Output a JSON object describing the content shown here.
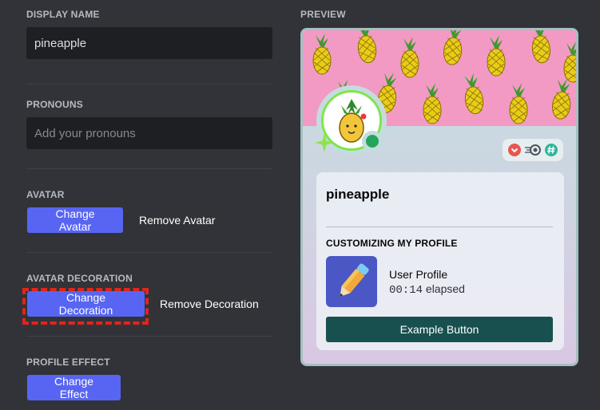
{
  "settings": {
    "display_name": {
      "label": "DISPLAY NAME",
      "value": "pineapple"
    },
    "pronouns": {
      "label": "PRONOUNS",
      "placeholder": "Add your pronouns"
    },
    "avatar": {
      "label": "AVATAR",
      "change": "Change Avatar",
      "remove": "Remove Avatar"
    },
    "decoration": {
      "label": "AVATAR DECORATION",
      "change": "Change Decoration",
      "remove": "Remove Decoration"
    },
    "effect": {
      "label": "PROFILE EFFECT",
      "change": "Change Effect"
    }
  },
  "preview": {
    "label": "PREVIEW",
    "username": "pineapple",
    "status": "online",
    "status_color": "#23a55a",
    "badges": [
      "heart-badge",
      "speed-badge",
      "hashtag-badge"
    ],
    "activity": {
      "section_title": "CUSTOMIZING MY PROFILE",
      "title": "User Profile",
      "timer": "00:14",
      "elapsed_suffix": " elapsed",
      "icon": "pencil-icon"
    },
    "example_button": "Example Button",
    "colors": {
      "banner": "#f29ac3",
      "button": "#17504f",
      "accent": "#5865f2"
    }
  }
}
